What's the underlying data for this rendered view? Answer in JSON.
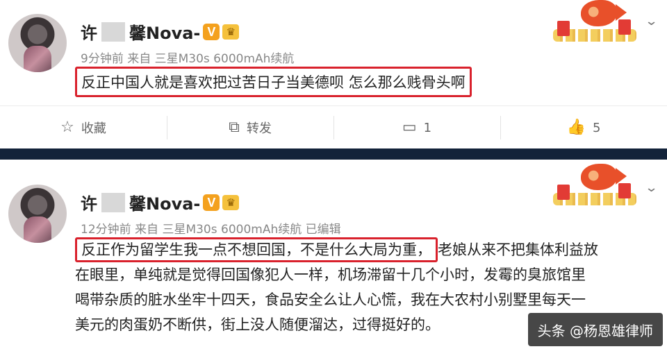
{
  "post1": {
    "username_prefix": "许",
    "username_suffix": "馨Nova-",
    "vip_badge": "V",
    "crown_icon": "crown-icon",
    "meta": "9分钟前  来自  三星M30s 6000mAh续航",
    "content": "反正中国人就是喜欢把过苦日子当美德呗 怎么那么贱骨头啊",
    "actions": [
      {
        "icon": "☆",
        "label": "收藏"
      },
      {
        "icon": "⧉",
        "label": "转发"
      },
      {
        "icon": "▭",
        "label": "1"
      },
      {
        "icon": "👍",
        "label": "5"
      }
    ]
  },
  "post2": {
    "username_prefix": "许",
    "username_suffix": "馨Nova-",
    "vip_badge": "V",
    "meta": "12分钟前  来自  三星M30s 6000mAh续航    已编辑",
    "content_highlight": "反正作为留学生我一点不想回国，不是什么大局为重，",
    "content_line1_rest": "老娘从来不把集体利益放",
    "content_line2": "在眼里，单纯就是觉得回国像犯人一样，机场滞留十几个小时，发霉的臭旅馆里",
    "content_line3": "喝带杂质的脏水坐牢十四天，食品安全么让人心慌，我在大农村小别墅里每天一",
    "content_line4": "美元的肉蛋奶不断供，街上没人随便溜达，过得挺好的。"
  },
  "watermark": {
    "text": "头条 @杨恩雄律师"
  },
  "colors": {
    "highlight_border": "#d9212c",
    "divider": "#13233a",
    "vip": "#f4a11e"
  }
}
